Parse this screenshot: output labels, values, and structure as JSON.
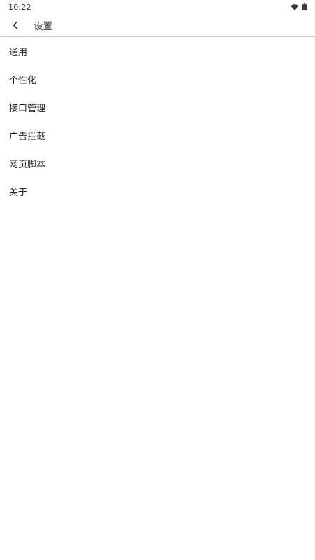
{
  "status_bar": {
    "time": "10:22",
    "icons": [
      "wifi-icon",
      "battery-icon"
    ]
  },
  "app_bar": {
    "back_icon": "chevron-left-icon",
    "title": "设置"
  },
  "settings": {
    "items": [
      {
        "label": "通用"
      },
      {
        "label": "个性化"
      },
      {
        "label": "接口管理"
      },
      {
        "label": "广告拦截"
      },
      {
        "label": "网页脚本"
      },
      {
        "label": "关于"
      }
    ]
  },
  "colors": {
    "background": "#ffffff",
    "text": "#222222",
    "divider": "#d6d6d6"
  }
}
